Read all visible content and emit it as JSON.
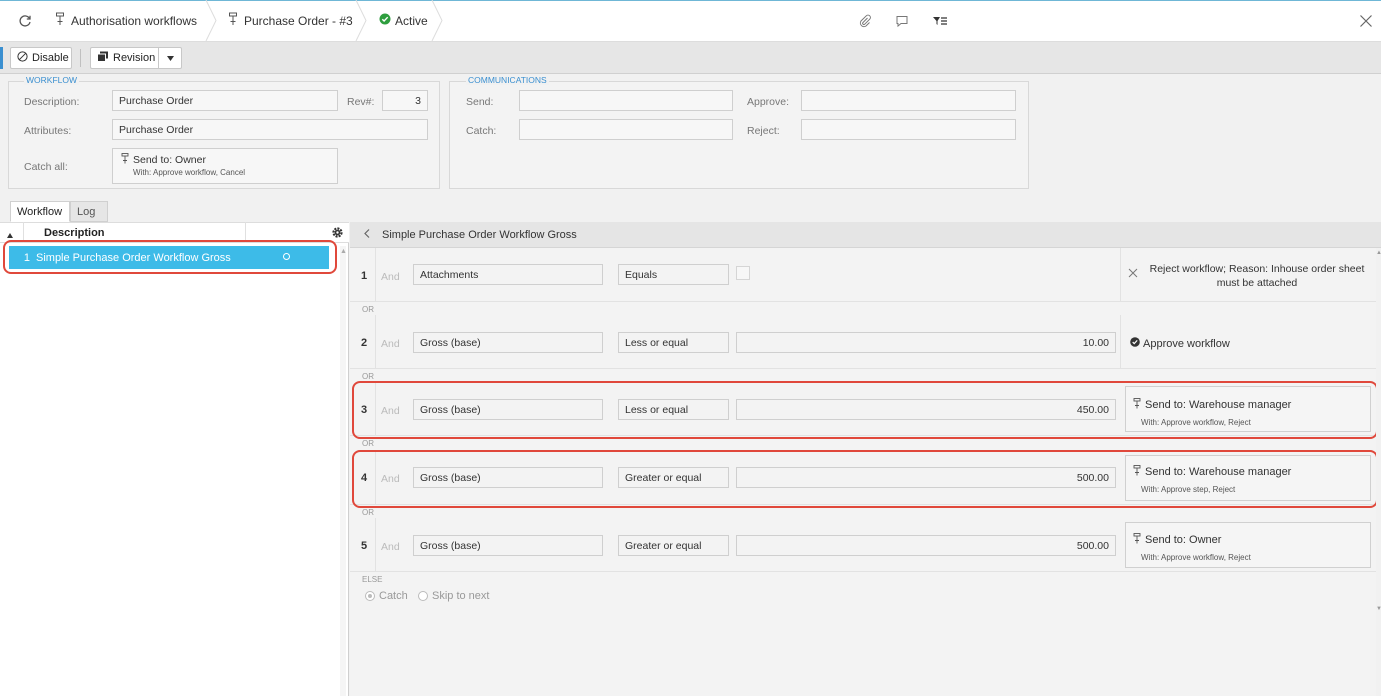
{
  "breadcrumbs": {
    "workflows": "Authorisation workflows",
    "record": "Purchase Order - #3",
    "status": "Active"
  },
  "toolbar": {
    "disable_label": "Disable",
    "revision_label": "Revision"
  },
  "workflow": {
    "group_label": "WORKFLOW",
    "description_label": "Description:",
    "description_value": "Purchase Order",
    "rev_label": "Rev#:",
    "rev_value": "3",
    "attributes_label": "Attributes:",
    "attributes_value": "Purchase Order",
    "catch_all_label": "Catch all:",
    "catch_all_send": "Send to: Owner",
    "catch_all_with": "With:  Approve workflow, Cancel"
  },
  "communications": {
    "group_label": "COMMUNICATIONS",
    "send_label": "Send:",
    "send_value": "",
    "approve_label": "Approve:",
    "approve_value": "",
    "catch_label": "Catch:",
    "catch_value": "",
    "reject_label": "Reject:",
    "reject_value": ""
  },
  "tabs": {
    "workflow": "Workflow",
    "log": "Log"
  },
  "grid": {
    "header_description": "Description",
    "rows": [
      {
        "num": "1",
        "description": "Simple Purchase Order Workflow Gross"
      }
    ]
  },
  "rules_panel": {
    "title": "Simple Purchase Order Workflow Gross",
    "or_label": "OR",
    "else_label": "ELSE",
    "catch_label": "Catch",
    "skip_label": "Skip to next",
    "rules": [
      {
        "num": "1",
        "and": "And",
        "field": "Attachments",
        "op": "Equals",
        "value": "",
        "action_title": "Reject workflow; Reason: Inhouse order sheet must be attached",
        "action_with": ""
      },
      {
        "num": "2",
        "and": "And",
        "field": "Gross (base)",
        "op": "Less or equal",
        "value": "10.00",
        "action_title": "Approve workflow",
        "action_with": ""
      },
      {
        "num": "3",
        "and": "And",
        "field": "Gross (base)",
        "op": "Less or equal",
        "value": "450.00",
        "action_title": "Send to: Warehouse manager",
        "action_with": "With:  Approve workflow, Reject"
      },
      {
        "num": "4",
        "and": "And",
        "field": "Gross (base)",
        "op": "Greater or equal",
        "value": "500.00",
        "action_title": "Send to: Warehouse manager",
        "action_with": "With:  Approve step, Reject"
      },
      {
        "num": "5",
        "and": "And",
        "field": "Gross (base)",
        "op": "Greater or equal",
        "value": "500.00",
        "action_title": "Send to: Owner",
        "action_with": "With:  Approve workflow, Reject"
      }
    ]
  },
  "colors": {
    "accent": "#3a8fd0",
    "selected_row": "#3dbbe8",
    "highlight": "#e0483b",
    "active_status": "#2e9e3e"
  }
}
